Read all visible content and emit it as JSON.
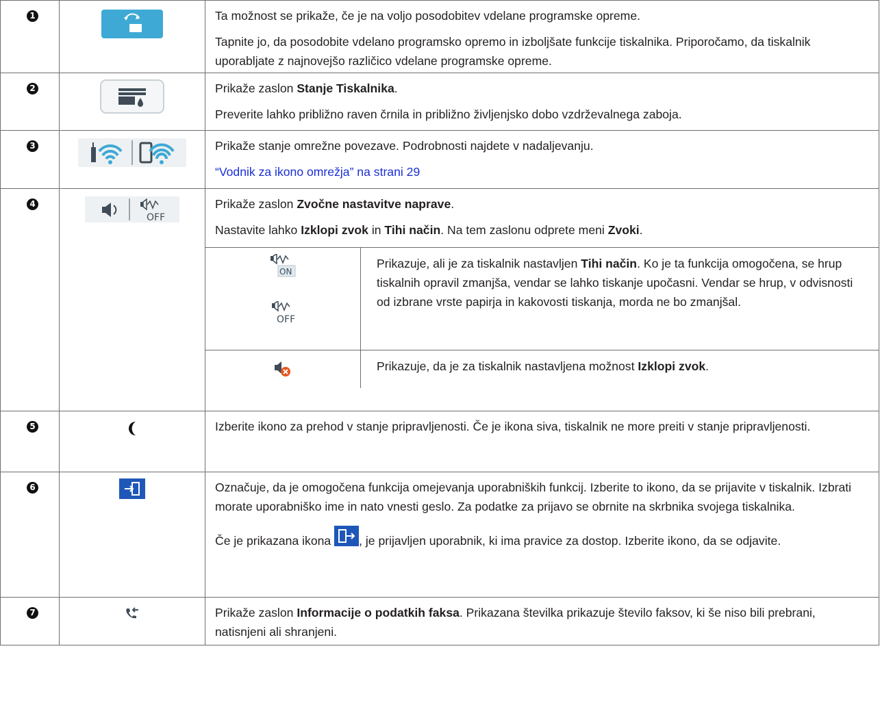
{
  "rows": [
    {
      "number": "1",
      "icon": "firmware-update-icon",
      "paragraphs": [
        "Ta možnost se prikaže, če je na voljo posodobitev vdelane programske opreme.",
        "Tapnite jo, da posodobite vdelano programsko opremo in izboljšate funkcije tiskalnika. Priporočamo, da tiskalnik uporabljate z najnovejšo različico vdelane programske opreme."
      ]
    },
    {
      "number": "2",
      "icon": "printer-status-icon",
      "line1": {
        "prefix": "Prikaže zaslon ",
        "bold": "Stanje Tiskalnika",
        "suffix": "."
      },
      "line2": "Preverite lahko približno raven črnila in približno življenjsko dobo vzdrževalnega zaboja."
    },
    {
      "number": "3",
      "icons": [
        "wifi-router-icon",
        "wifi-direct-phone-icon"
      ],
      "line1": "Prikaže stanje omrežne povezave. Podrobnosti najdete v nadaljevanju.",
      "link": "“Vodnik za ikono omrežja” na strani 29"
    },
    {
      "number": "4",
      "icons": [
        "speaker-icon",
        "quiet-mode-off-icon"
      ],
      "line1": {
        "prefix": "Prikaže zaslon ",
        "bold": "Zvočne nastavitve naprave",
        "suffix": "."
      },
      "line2": {
        "a": "Nastavite lahko ",
        "b1": "Izklopi zvok",
        "c": " in ",
        "b2": "Tihi način",
        "d": ". Na tem zaslonu odprete meni ",
        "b3": "Zvoki",
        "e": "."
      },
      "sub": [
        {
          "icons": [
            "quiet-mode-on-icon",
            "quiet-mode-off-icon"
          ],
          "prefix": "Prikazuje, ali je za tiskalnik nastavljen ",
          "bold": "Tihi način",
          "suffix": ". Ko je ta funkcija omogočena, se hrup tiskalnih opravil zmanjša, vendar se lahko tiskanje upočasni. Vendar se hrup, v odvisnosti od izbrane vrste papirja in kakovosti tiskanja, morda ne bo zmanjšal."
        },
        {
          "icons": [
            "mute-icon"
          ],
          "prefix": "Prikazuje, da je za tiskalnik nastavljena možnost ",
          "bold": "Izklopi zvok",
          "suffix": "."
        }
      ]
    },
    {
      "number": "5",
      "icon": "sleep-moon-icon",
      "paragraphs": [
        "Izberite ikono za prehod v stanje pripravljenosti. Če je ikona siva, tiskalnik ne more preiti v stanje pripravljenosti."
      ]
    },
    {
      "number": "6",
      "icon": "login-icon",
      "line1": "Označuje, da je omogočena funkcija omejevanja uporabniških funkcij. Izberite to ikono, da se prijavite v tiskalnik. Izbrati morate uporabniško ime in nato vnesti geslo. Za podatke za prijavo se obrnite na skrbnika svojega tiskalnika.",
      "line2": {
        "prefix": "Če je prikazana ikona ",
        "icon": "logout-icon",
        "suffix": ", je prijavljen uporabnik, ki ima pravice za dostop. Izberite ikono, da se odjavite."
      }
    },
    {
      "number": "7",
      "icon": "fax-info-icon",
      "line1": {
        "prefix": "Prikaže zaslon ",
        "bold": "Informacije o podatkih faksa",
        "suffix": ". Prikazana številka prikazuje število faksov, ki še niso bili prebrani, natisnjeni ali shranjeni."
      }
    }
  ]
}
